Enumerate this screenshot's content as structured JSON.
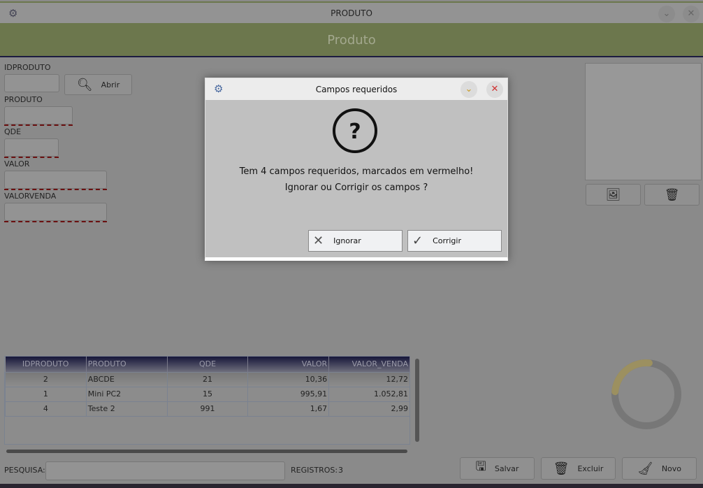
{
  "window": {
    "title": "PRODUTO",
    "header": "Produto"
  },
  "form": {
    "fields": [
      {
        "label": "IDPRODUTO",
        "value": "",
        "required": false
      },
      {
        "label": "PRODUTO",
        "value": "",
        "required": true
      },
      {
        "label": "QDE",
        "value": "",
        "required": true
      },
      {
        "label": "VALOR",
        "value": "",
        "required": true
      },
      {
        "label": "VALORVENDA",
        "value": "",
        "required": true
      }
    ],
    "open_button": "Abrir"
  },
  "table": {
    "columns": [
      "IDPRODUTO",
      "PRODUTO",
      "QDE",
      "VALOR",
      "VALOR_VENDA"
    ],
    "rows": [
      [
        "2",
        "ABCDE",
        "21",
        "10,36",
        "12,72"
      ],
      [
        "1",
        "Mini PC2",
        "15",
        "995,91",
        "1.052,81"
      ],
      [
        "4",
        "Teste 2",
        "991",
        "1,67",
        "2,99"
      ]
    ]
  },
  "footer": {
    "search_label": "PESQUISA:",
    "search_value": "",
    "records_label": "REGISTROS:",
    "records_count": "3"
  },
  "actions": {
    "save": "Salvar",
    "delete": "Excluir",
    "new": "Novo"
  },
  "progress_ring": {
    "fraction": 0.25,
    "color": "#9c9060"
  },
  "dialog": {
    "title": "Campos requeridos",
    "message_line1": "Tem 4 campos requeridos, marcados em vermelho!",
    "message_line2": "Ignorar ou Corrigir os campos ?",
    "ignore_button": "Ignorar",
    "fix_button": "Corrigir"
  },
  "colors": {
    "header": "#6c774d",
    "required_marker": "#6a1010",
    "dialog_close": "#d03030",
    "dialog_minimize": "#c89a20"
  }
}
